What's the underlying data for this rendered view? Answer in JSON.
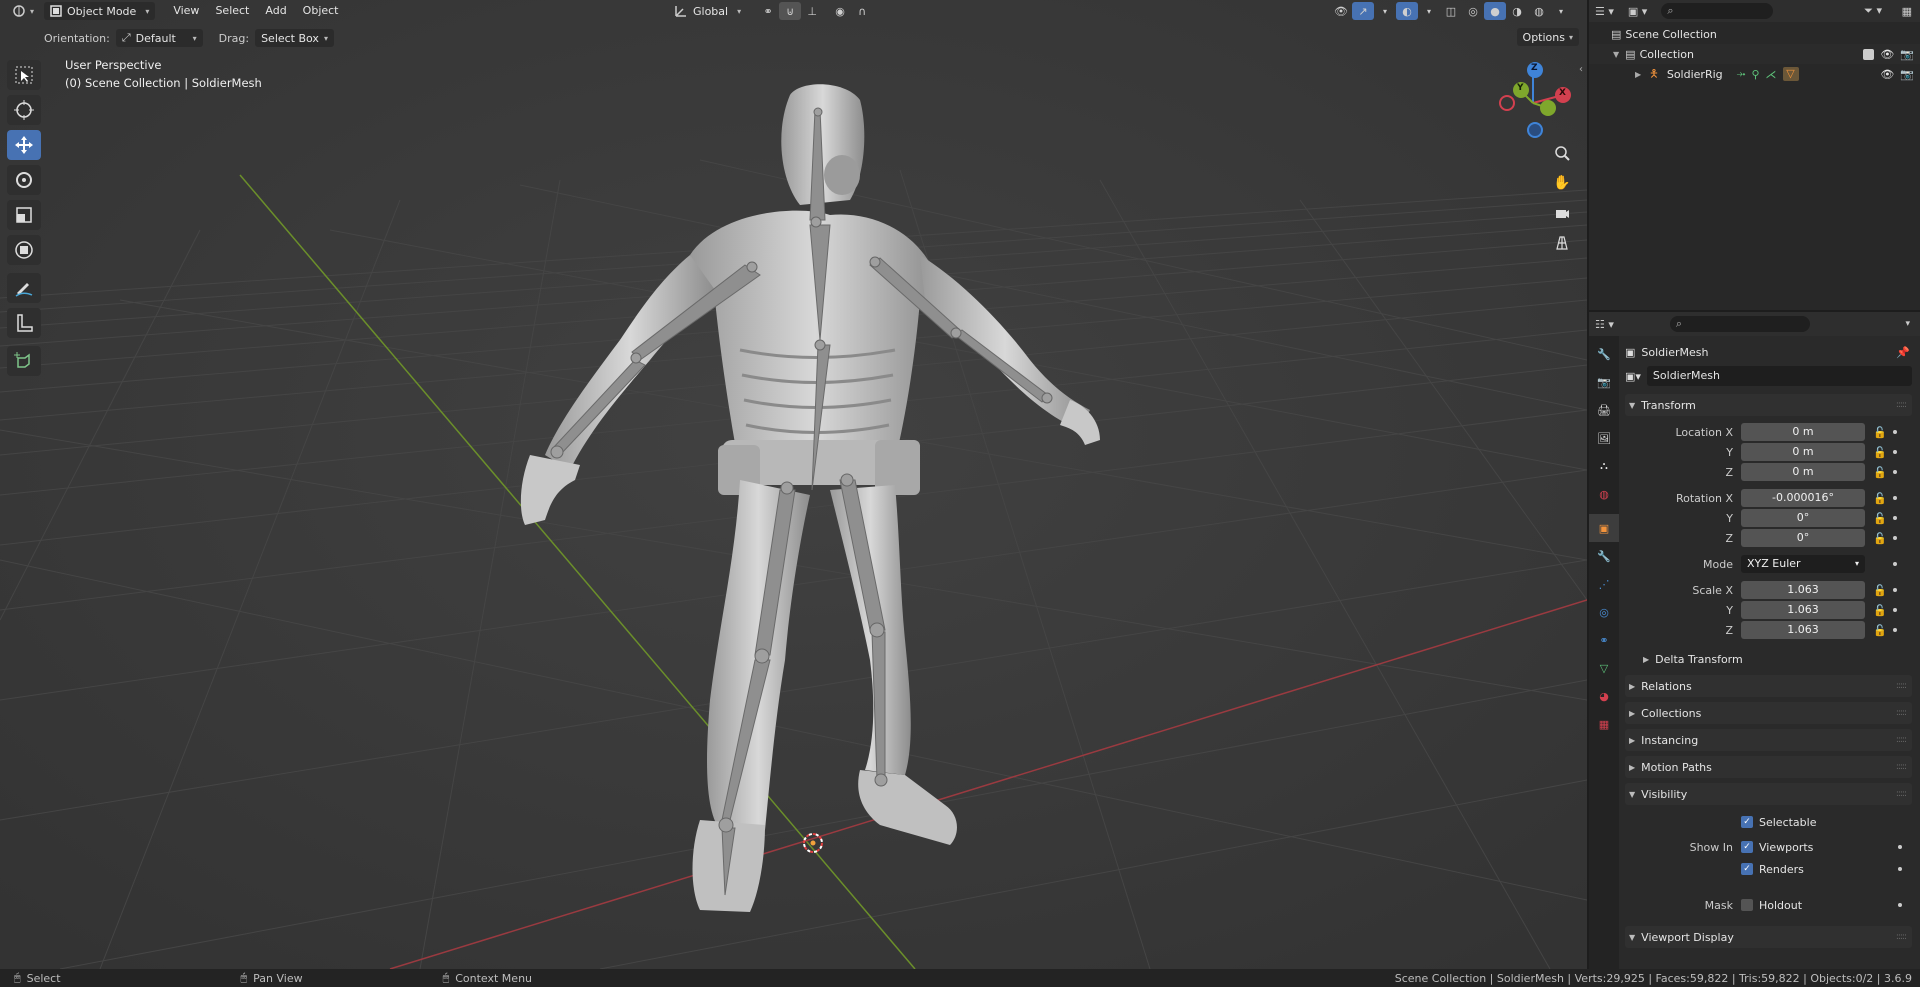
{
  "viewport_header": {
    "mode": "Object Mode",
    "menus": [
      "View",
      "Select",
      "Add",
      "Object"
    ],
    "transform_orientation": "Global"
  },
  "tool_settings": {
    "orientation_label": "Orientation:",
    "orientation_value": "Default",
    "drag_label": "Drag:",
    "drag_value": "Select Box",
    "options": "Options"
  },
  "viewport": {
    "view_name": "User Perspective",
    "collection_info": "(0) Scene Collection | SoldierMesh",
    "gizmo_axes": [
      "X",
      "Y",
      "Z"
    ]
  },
  "outliner": {
    "scene_collection": "Scene Collection",
    "collection": "Collection",
    "object": "SoldierRig"
  },
  "properties": {
    "object_name": "SoldierMesh",
    "data_name": "SoldierMesh",
    "transform": {
      "title": "Transform",
      "location_label": "Location X",
      "location": [
        "0 m",
        "0 m",
        "0 m"
      ],
      "rotation_label": "Rotation X",
      "rotation": [
        "-0.000016°",
        "0°",
        "0°"
      ],
      "mode_label": "Mode",
      "mode": "XYZ Euler",
      "scale_label": "Scale X",
      "scale": [
        "1.063",
        "1.063",
        "1.063"
      ],
      "y_label": "Y",
      "z_label": "Z"
    },
    "delta_transform": "Delta Transform",
    "panels": [
      "Relations",
      "Collections",
      "Instancing",
      "Motion Paths"
    ],
    "visibility": {
      "title": "Visibility",
      "selectable": "Selectable",
      "show_in_label": "Show In",
      "viewports": "Viewports",
      "renders": "Renders",
      "mask_label": "Mask",
      "holdout": "Holdout"
    },
    "viewport_display": "Viewport Display"
  },
  "status_bar": {
    "select": "Select",
    "pan_view": "Pan View",
    "context_menu": "Context Menu",
    "stats": "Scene Collection | SoldierMesh | Verts:29,925 | Faces:59,822 | Tris:59,822 | Objects:0/2 | 3.6.9"
  },
  "colors": {
    "accent": "#4772b3",
    "x_axis": "#d3404f",
    "y_axis": "#7fa72c",
    "z_axis": "#3f84d8",
    "object_orange": "#f2933c"
  }
}
